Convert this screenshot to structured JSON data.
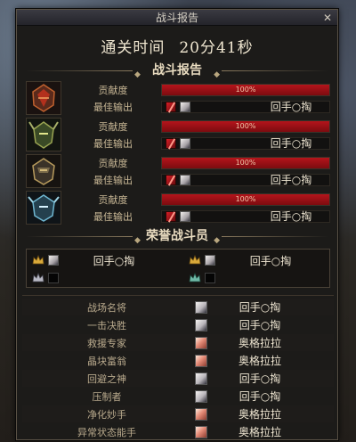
{
  "window": {
    "title": "战斗报告",
    "close_label": "✕"
  },
  "clear_time": {
    "label": "通关时间",
    "value": "20分41秒"
  },
  "battle_report": {
    "header": "战斗报告",
    "row1_label": "贡献度",
    "row2_label": "最佳输出",
    "players": [
      {
        "portrait": "red-armored-warrior-icon",
        "contribution": "100%",
        "contribution_pct": 100,
        "best_skill_player": "回手○掏"
      },
      {
        "portrait": "green-horned-knight-icon",
        "contribution": "100%",
        "contribution_pct": 100,
        "best_skill_player": "回手○掏"
      },
      {
        "portrait": "gold-dark-knight-icon",
        "contribution": "100%",
        "contribution_pct": 100,
        "best_skill_player": "回手○掏"
      },
      {
        "portrait": "blue-crystal-knight-icon",
        "contribution": "100%",
        "contribution_pct": 100,
        "best_skill_player": "回手○掏"
      }
    ]
  },
  "honor": {
    "header": "荣誉战斗员",
    "slots": [
      {
        "crown": "gold-crown-icon",
        "name": "回手○掏"
      },
      {
        "crown": "gold-crown-icon",
        "name": "回手○掏"
      },
      {
        "crown": "silver-crown-icon",
        "name": ""
      },
      {
        "crown": "teal-crown-icon",
        "name": ""
      }
    ]
  },
  "awards": [
    {
      "title": "战场名将",
      "portrait": "white",
      "winner": "回手○掏"
    },
    {
      "title": "一击决胜",
      "portrait": "white",
      "winner": "回手○掏"
    },
    {
      "title": "救援专家",
      "portrait": "red",
      "winner": "奥格拉拉"
    },
    {
      "title": "晶块富翁",
      "portrait": "red",
      "winner": "奥格拉拉"
    },
    {
      "title": "回避之神",
      "portrait": "white",
      "winner": "回手○掏"
    },
    {
      "title": "压制者",
      "portrait": "white",
      "winner": "回手○掏"
    },
    {
      "title": "净化妙手",
      "portrait": "red",
      "winner": "奥格拉拉"
    },
    {
      "title": "异常状态能手",
      "portrait": "red",
      "winner": "奥格拉拉"
    }
  ],
  "colors": {
    "accent_red": "#b5141b",
    "gold_text": "#e9dcc0"
  }
}
